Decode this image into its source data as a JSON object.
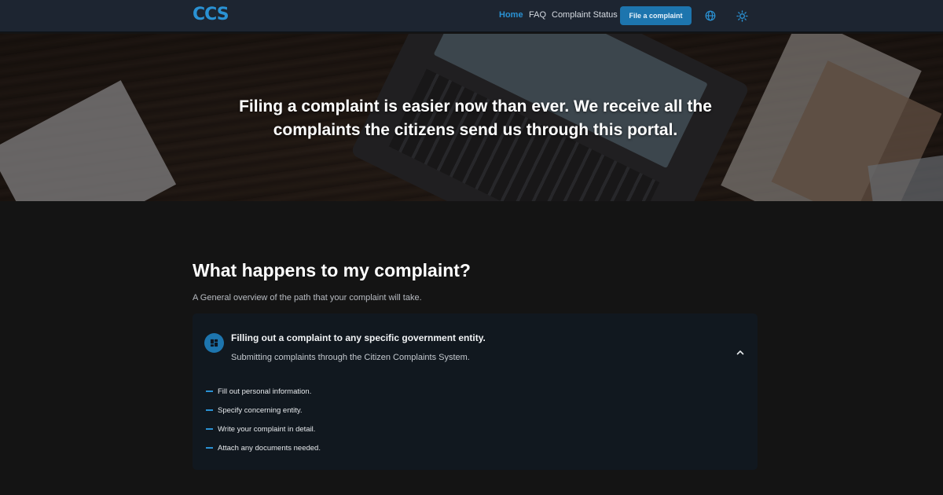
{
  "navbar": {
    "logo": "CCS",
    "links": [
      "Home",
      "FAQ",
      "Complaint Status"
    ],
    "cta_label": "File a complaint",
    "icons": [
      "globe-icon",
      "sun-icon"
    ]
  },
  "hero": {
    "title": "Filing a complaint is easier now than ever. We receive all the complaints the citizens send us through this portal."
  },
  "main": {
    "title": "What happens to my complaint?",
    "subtitle": "A General overview of the path that your complaint will take.",
    "card": {
      "icon": "dashboard-icon",
      "title": "Filling out a complaint to any specific government entity.",
      "subtitle": "Submitting complaints through the Citizen Complaints System.",
      "steps": [
        "Fill out personal information.",
        "Specify concerning entity.",
        "Write your complaint in detail.",
        "Attach any documents needed."
      ],
      "expanded": true
    }
  },
  "colors": {
    "accent": "#2a92d4",
    "button": "#1d75ae",
    "navbar_bg": "#1d2531",
    "page_bg": "#141414",
    "card_bg": "#11181f"
  }
}
